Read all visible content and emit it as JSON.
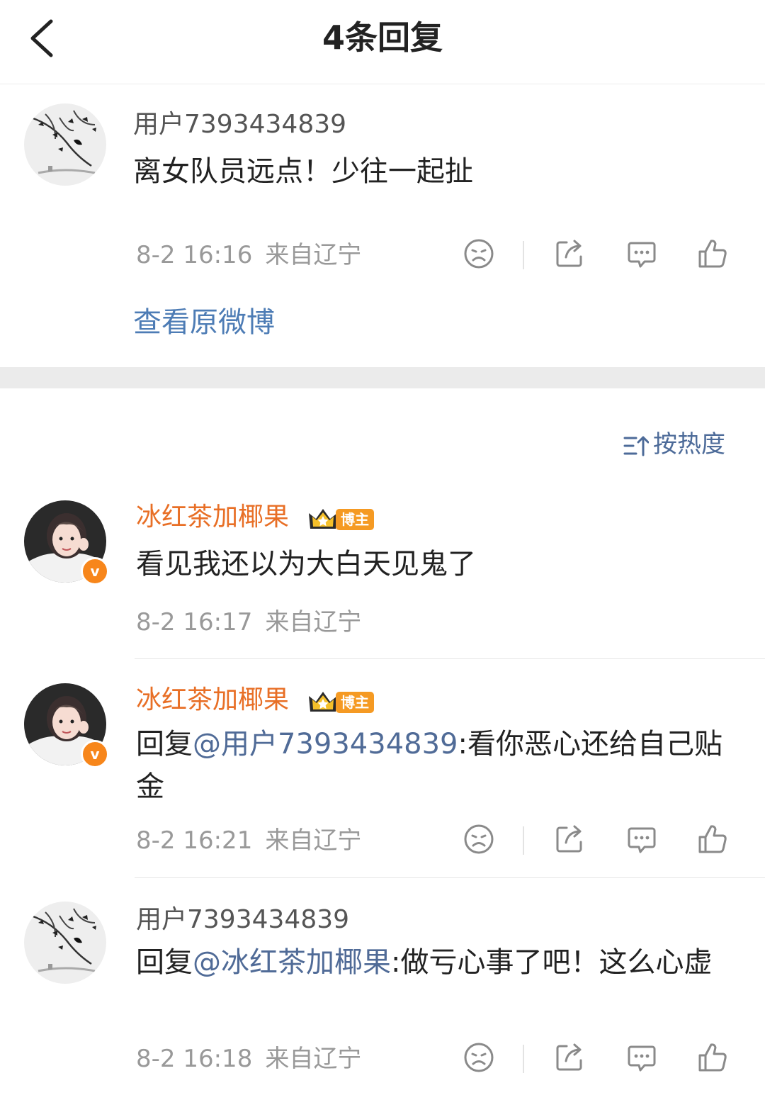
{
  "header": {
    "title": "4条回复",
    "back_icon": "chevron-left-icon"
  },
  "root_comment": {
    "username": "用户7393434839",
    "text": "离女队员远点！少往一起扯",
    "date": "8-2 16:16",
    "location": "来自辽宁",
    "view_original": "查看原微博"
  },
  "sort": {
    "label": "按热度",
    "icon": "sort-icon"
  },
  "replies": [
    {
      "username": "冰红茶加椰果",
      "badge": "博主",
      "text": "看见我还以为大白天见鬼了",
      "date": "8-2 16:17",
      "location": "来自辽宁"
    },
    {
      "username": "冰红茶加椰果",
      "badge": "博主",
      "reply_prefix": "回复",
      "mention": "@用户7393434839",
      "text": ":看你恶心还给自己贴金",
      "date": "8-2 16:21",
      "location": "来自辽宁"
    },
    {
      "username": "用户7393434839",
      "reply_prefix": "回复",
      "mention": "@冰红茶加椰果",
      "text": ":做亏心事了吧！这么心虚",
      "date": "8-2 16:18",
      "location": "来自辽宁"
    }
  ],
  "colors": {
    "username_verified": "#e86f26",
    "mention": "#506b97",
    "link": "#4d7cb5",
    "meta": "#999999"
  }
}
